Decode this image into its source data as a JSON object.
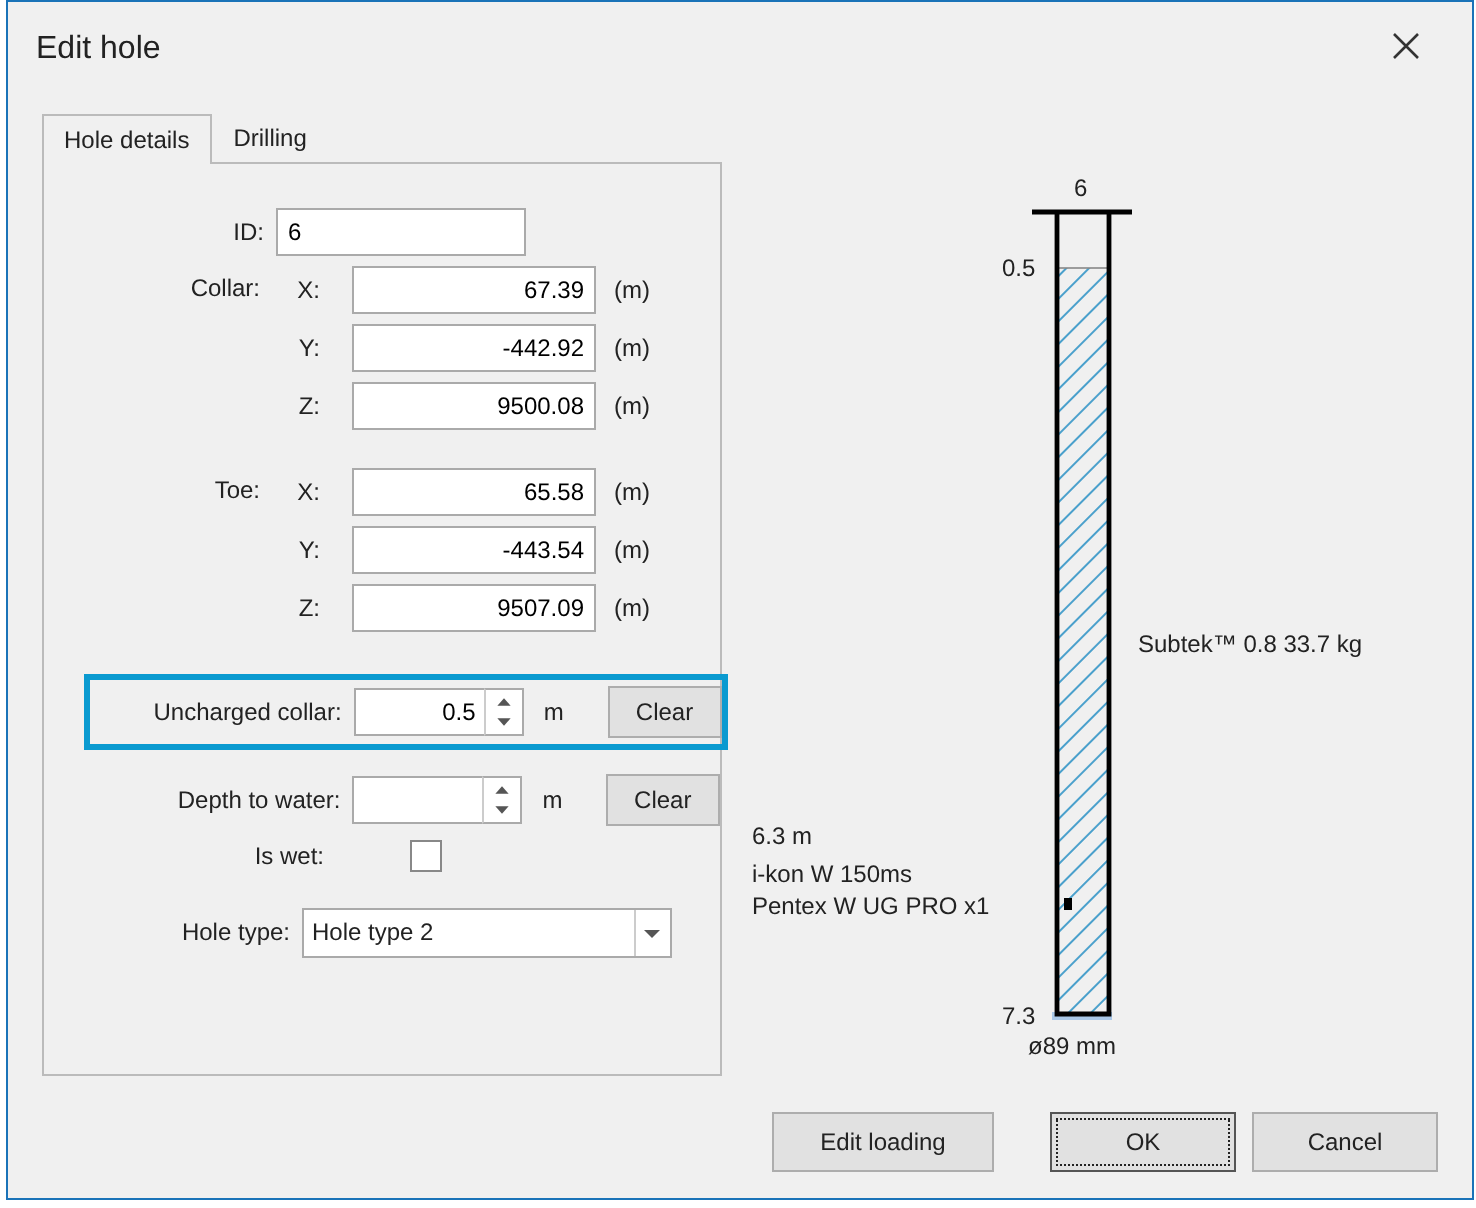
{
  "window": {
    "title": "Edit hole"
  },
  "tabs": [
    {
      "label": "Hole details",
      "selected": true
    },
    {
      "label": "Drilling",
      "selected": false
    }
  ],
  "id_field": {
    "label": "ID:",
    "value": "6"
  },
  "collar": {
    "label": "Collar:",
    "coords": [
      {
        "axis": "X:",
        "value": "67.39",
        "unit": "(m)"
      },
      {
        "axis": "Y:",
        "value": "-442.92",
        "unit": "(m)"
      },
      {
        "axis": "Z:",
        "value": "9500.08",
        "unit": "(m)"
      }
    ]
  },
  "toe": {
    "label": "Toe:",
    "coords": [
      {
        "axis": "X:",
        "value": "65.58",
        "unit": "(m)"
      },
      {
        "axis": "Y:",
        "value": "-443.54",
        "unit": "(m)"
      },
      {
        "axis": "Z:",
        "value": "9507.09",
        "unit": "(m)"
      }
    ]
  },
  "spin_fields": [
    {
      "label": "Uncharged collar:",
      "value": "0.5",
      "unit": "m",
      "button": "Clear",
      "highlighted": true
    },
    {
      "label": "Depth to water:",
      "unit": "m",
      "button": "Clear",
      "highlighted": false
    }
  ],
  "is_wet": {
    "label": "Is wet:",
    "checked": false
  },
  "hole_type": {
    "label": "Hole type:",
    "value": "Hole type 2"
  },
  "diagram": {
    "hole_id": "6",
    "top_depth": "0.5",
    "bottom_depth": "7.3",
    "diameter": "ø89 mm",
    "charge_label": "Subtek™ 0.8 33.7 kg",
    "primer_lines": [
      "6.3 m",
      "i-kon W 150ms",
      "Pentex W UG PRO x1"
    ]
  },
  "buttons": [
    {
      "label": "Edit loading",
      "default": false
    },
    {
      "label": "OK",
      "default": true
    },
    {
      "label": "Cancel",
      "default": false
    }
  ]
}
